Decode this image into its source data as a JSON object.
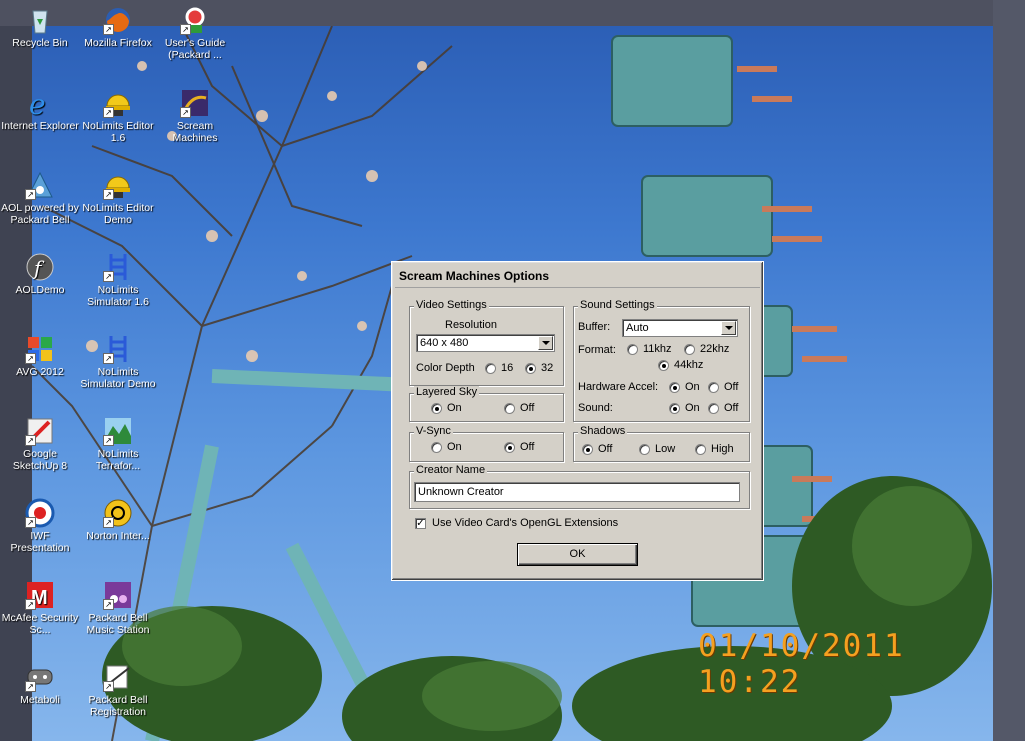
{
  "desktop": {
    "timestamp": "01/10/2011  10:22",
    "icons": [
      {
        "label": "Recycle Bin",
        "icon": "recycle-bin-icon"
      },
      {
        "label": "Mozilla Firefox",
        "icon": "firefox-icon"
      },
      {
        "label": "User's Guide (Packard ...",
        "icon": "users-guide-icon"
      },
      {
        "label": "Internet Explorer",
        "icon": "internet-explorer-icon"
      },
      {
        "label": "NoLimits Editor 1.6",
        "icon": "nolimits-editor-icon"
      },
      {
        "label": "Scream Machines",
        "icon": "scream-machines-icon"
      },
      {
        "label": "AOL powered by Packard Bell",
        "icon": "aol-icon"
      },
      {
        "label": "NoLimits Editor Demo",
        "icon": "nolimits-editor-demo-icon"
      },
      {
        "label": "AOLDemo",
        "icon": "aoldemo-icon"
      },
      {
        "label": "NoLimits Simulator 1.6",
        "icon": "nolimits-simulator-icon"
      },
      {
        "label": "AVG 2012",
        "icon": "avg-icon"
      },
      {
        "label": "NoLimits Simulator Demo",
        "icon": "nolimits-simulator-demo-icon"
      },
      {
        "label": "Google SketchUp 8",
        "icon": "sketchup-icon"
      },
      {
        "label": "NoLimits Terrafor...",
        "icon": "nolimits-terraformer-icon"
      },
      {
        "label": "IWF Presentation",
        "icon": "iwf-presentation-icon"
      },
      {
        "label": "Norton Inter...",
        "icon": "norton-icon"
      },
      {
        "label": "McAfee Security Sc...",
        "icon": "mcafee-icon"
      },
      {
        "label": "Packard Bell Music Station",
        "icon": "music-station-icon"
      },
      {
        "label": "Metaboli",
        "icon": "metaboli-icon"
      },
      {
        "label": "Packard Bell Registration",
        "icon": "registration-icon"
      }
    ]
  },
  "dialog": {
    "title": "Scream Machines Options",
    "video": {
      "group_title": "Video Settings",
      "resolution_label": "Resolution",
      "resolution_value": "640 x 480",
      "color_depth_label": "Color Depth",
      "depth_16": "16",
      "depth_32": "32",
      "selected_depth": "32"
    },
    "layered_sky": {
      "group_title": "Layered Sky",
      "on": "On",
      "off": "Off",
      "selected": "On"
    },
    "vsync": {
      "group_title": "V-Sync",
      "on": "On",
      "off": "Off",
      "selected": "Off"
    },
    "sound": {
      "group_title": "Sound Settings",
      "buffer_label": "Buffer:",
      "buffer_value": "Auto",
      "format_label": "Format:",
      "format_11": "11khz",
      "format_22": "22khz",
      "format_44": "44khz",
      "selected_format": "44khz",
      "hw_accel_label": "Hardware Accel:",
      "hw_on": "On",
      "hw_off": "Off",
      "hw_selected": "On",
      "sound_label": "Sound:",
      "sound_on": "On",
      "sound_off": "Off",
      "sound_selected": "On"
    },
    "shadows": {
      "group_title": "Shadows",
      "off": "Off",
      "low": "Low",
      "high": "High",
      "selected": "Off"
    },
    "creator": {
      "group_title": "Creator Name",
      "value": "Unknown Creator"
    },
    "opengl_label": "Use Video Card's OpenGL Extensions",
    "opengl_checked": true,
    "ok_label": "OK"
  }
}
